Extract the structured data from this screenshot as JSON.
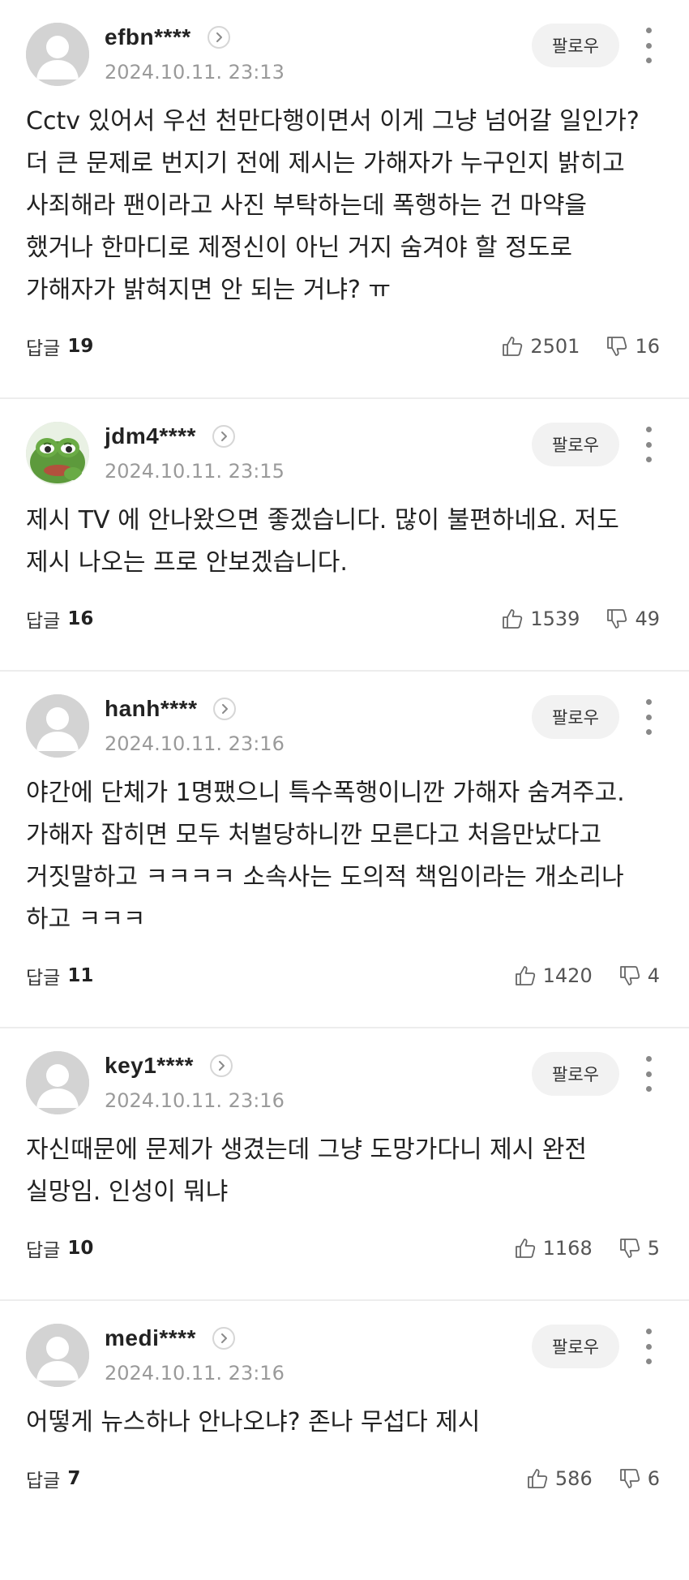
{
  "ui": {
    "follow_label": "팔로우",
    "reply_label": "답글"
  },
  "comments": [
    {
      "nickname": "efbn****",
      "date": "2024.10.11. 23:13",
      "avatar": "default-avatar",
      "text": "Cctv 있어서 우선 천만다행이면서 이게 그냥 넘어갈 일인가? 더 큰 문제로 번지기 전에 제시는 가해자가 누구인지 밝히고 사죄해라 팬이라고 사진 부탁하는데 폭행하는 건 마약을 했거나 한마디로 제정신이 아닌 거지 숨겨야 할 정도로 가해자가 밝혀지면 안 되는 거냐? ㅠ",
      "replies": "19",
      "likes": "2501",
      "dislikes": "16"
    },
    {
      "nickname": "jdm4****",
      "date": "2024.10.11. 23:15",
      "avatar": "frog-avatar",
      "text": "제시 TV 에 안나왔으면 좋겠습니다. 많이 불편하네요. 저도 제시 나오는 프로 안보겠습니다.",
      "replies": "16",
      "likes": "1539",
      "dislikes": "49"
    },
    {
      "nickname": "hanh****",
      "date": "2024.10.11. 23:16",
      "avatar": "default-avatar",
      "text": "야간에 단체가 1명팼으니 특수폭행이니깐 가해자 숨겨주고. 가해자 잡히면 모두 처벌당하니깐 모른다고 처음만났다고 거짓말하고 ㅋㅋㅋㅋ 소속사는 도의적 책임이라는 개소리나 하고 ㅋㅋㅋ",
      "replies": "11",
      "likes": "1420",
      "dislikes": "4"
    },
    {
      "nickname": "key1****",
      "date": "2024.10.11. 23:16",
      "avatar": "default-avatar",
      "text": "자신때문에 문제가 생겼는데 그냥 도망가다니 제시 완전 실망임. 인성이 뭐냐",
      "replies": "10",
      "likes": "1168",
      "dislikes": "5"
    },
    {
      "nickname": "medi****",
      "date": "2024.10.11. 23:16",
      "avatar": "default-avatar",
      "text": "어떻게 뉴스하나 안나오냐? 존나 무섭다 제시",
      "replies": "7",
      "likes": "586",
      "dislikes": "6"
    }
  ],
  "colors": {
    "avatar_bg": "#d3d3d3",
    "muted_text": "#9a9a9a",
    "follow_bg": "#f2f2f2",
    "divider": "#ededed"
  }
}
